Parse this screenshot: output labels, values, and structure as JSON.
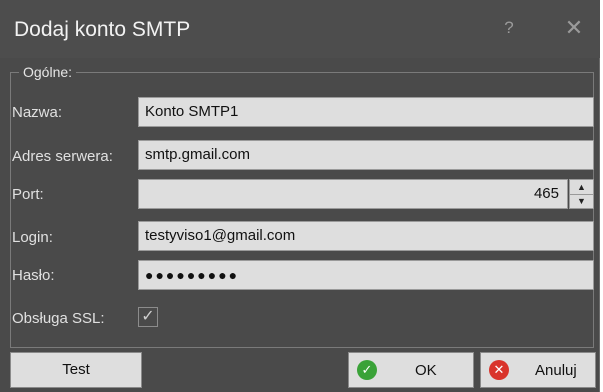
{
  "dialog": {
    "title": "Dodaj konto SMTP",
    "help_glyph": "?",
    "close_glyph": "✕"
  },
  "group": {
    "legend": "Ogólne:"
  },
  "fields": {
    "name": {
      "label": "Nazwa:",
      "value": "Konto SMTP1"
    },
    "server": {
      "label": "Adres serwera:",
      "value": "smtp.gmail.com"
    },
    "port": {
      "label": "Port:",
      "value": "465",
      "up_glyph": "▲",
      "down_glyph": "▼"
    },
    "login": {
      "label": "Login:",
      "value": "testyviso1@gmail.com"
    },
    "password": {
      "label": "Hasło:",
      "masked_value": "●●●●●●●●●"
    },
    "ssl": {
      "label": "Obsługa SSL:",
      "checked": true,
      "check_glyph": "✓"
    }
  },
  "buttons": {
    "test": "Test",
    "ok": "OK",
    "cancel": "Anuluj",
    "ok_icon_glyph": "✓",
    "cancel_icon_glyph": "✕"
  },
  "colors": {
    "background": "#4a4a4a",
    "field": "#dedede",
    "ok_icon": "#3aa238",
    "cancel_icon": "#d9342b"
  }
}
